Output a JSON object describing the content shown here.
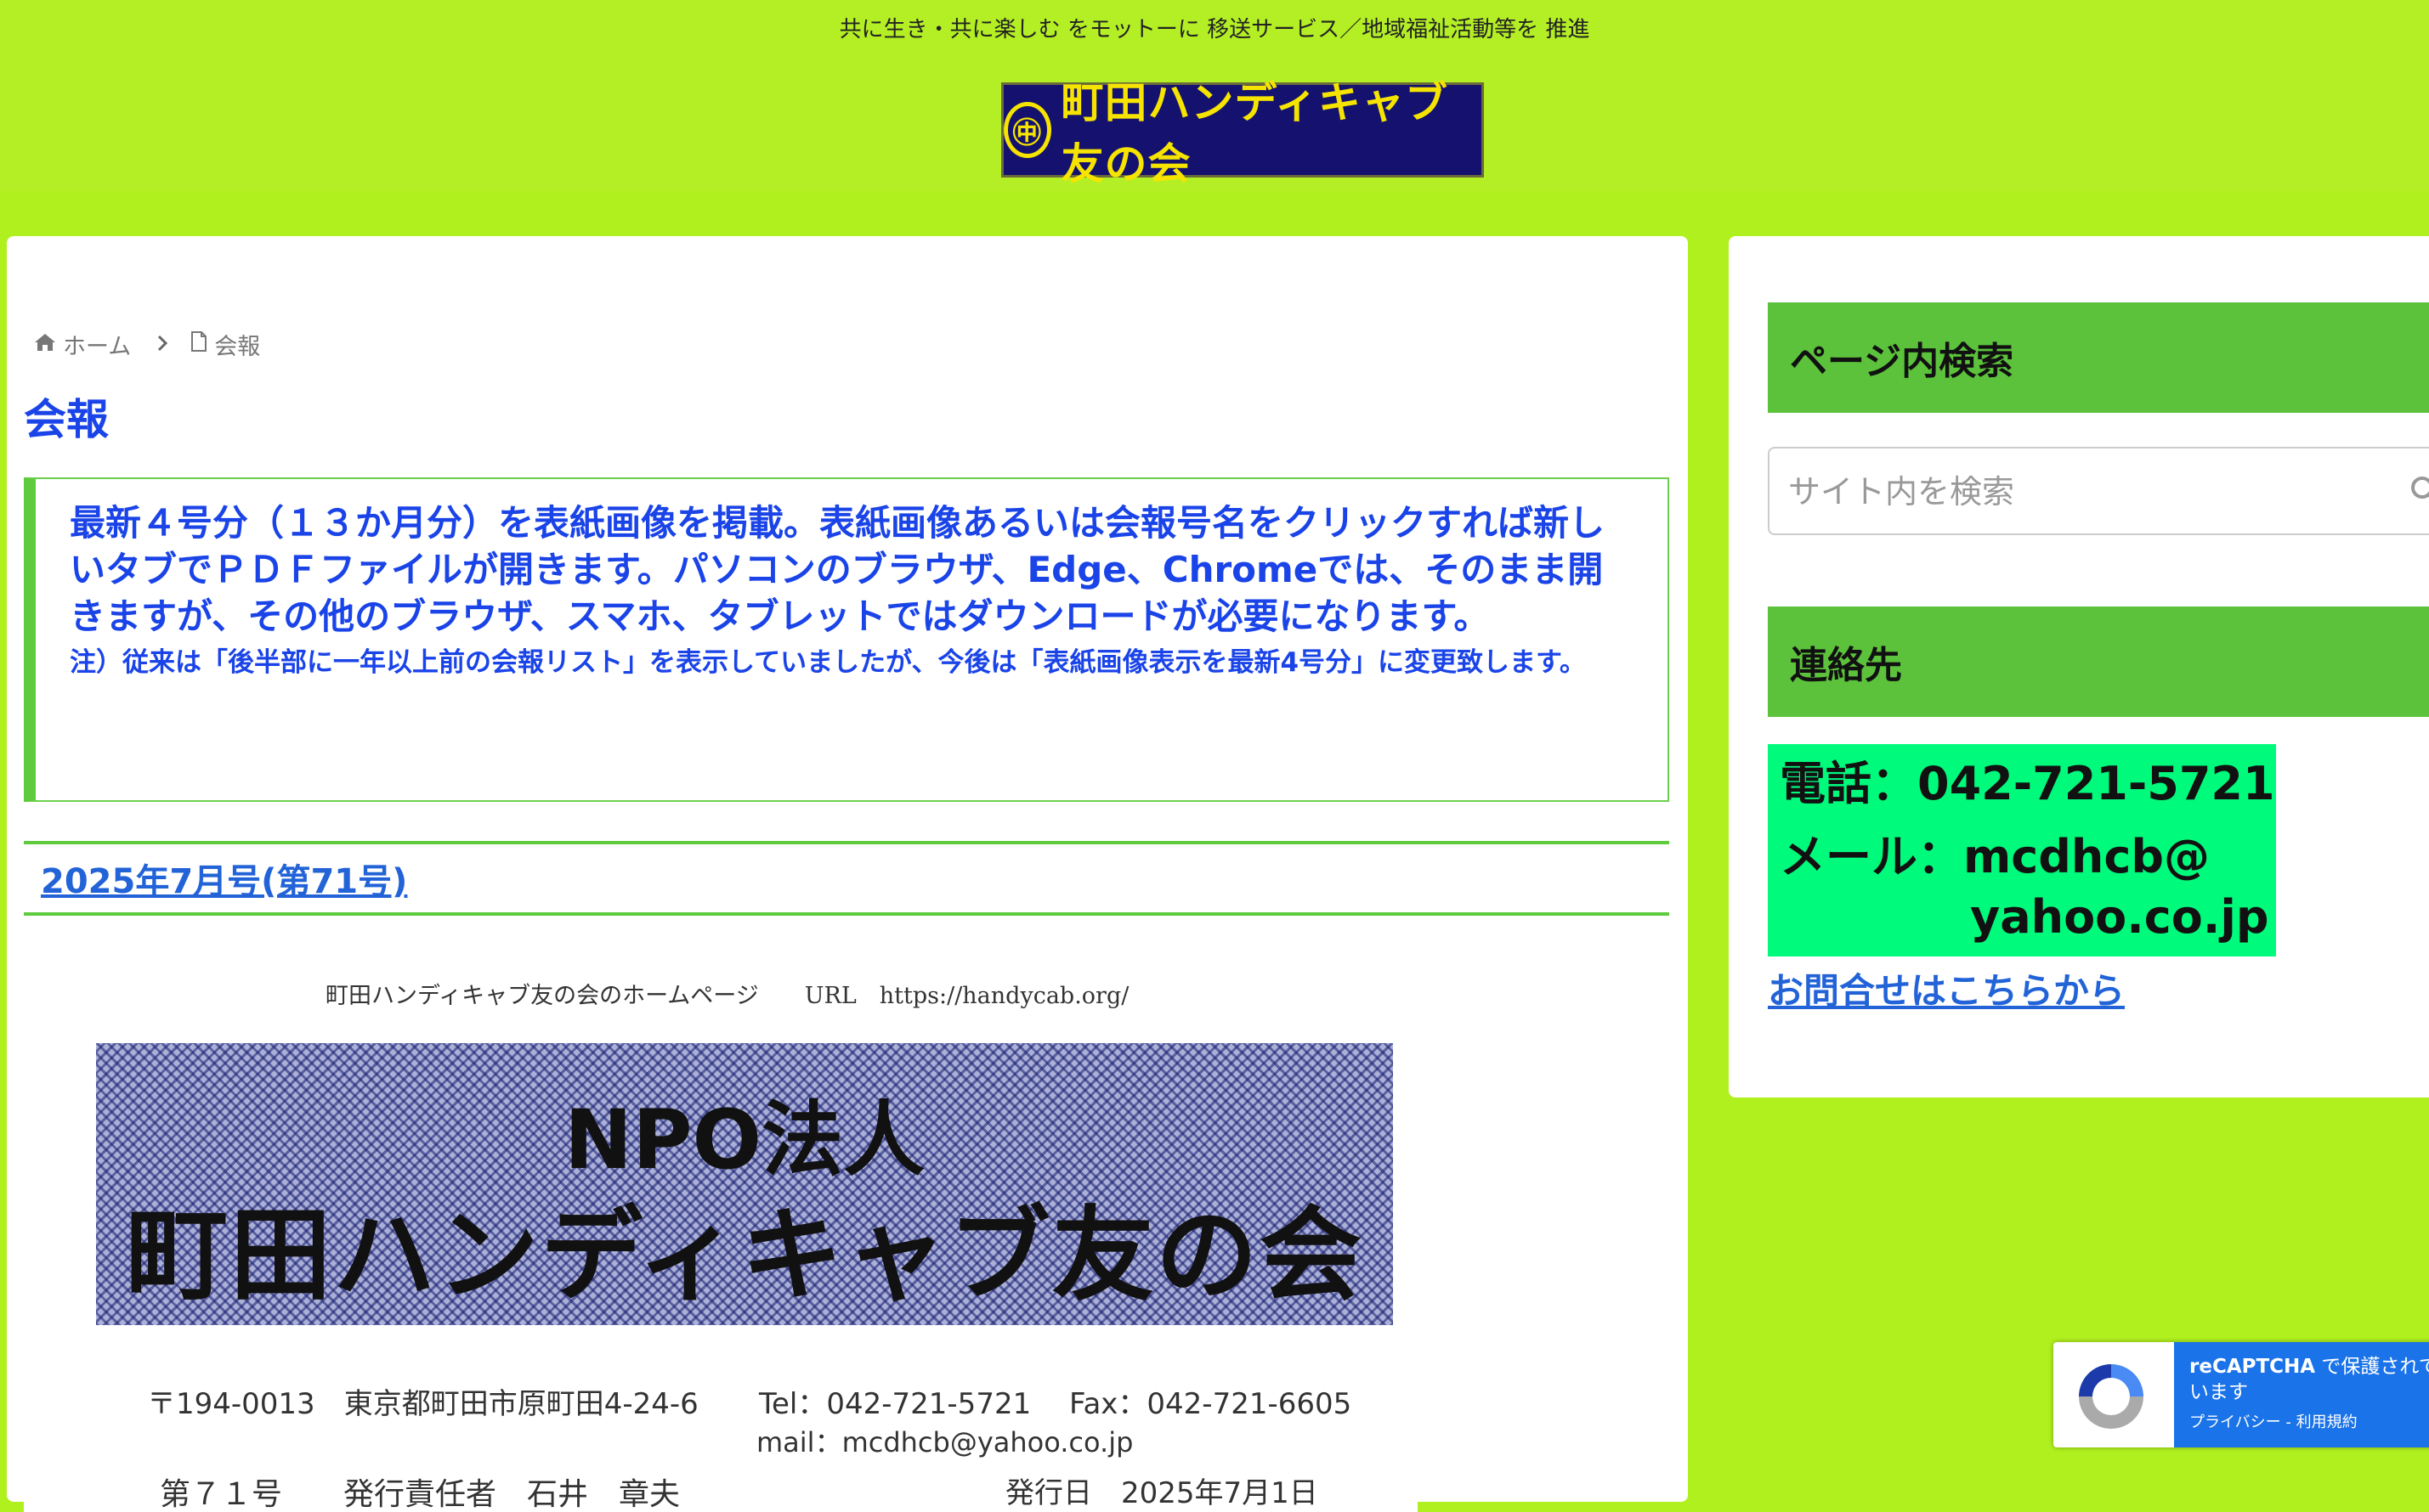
{
  "header": {
    "tagline": "共に生き・共に楽しむ をモットーに 移送サービス／地域福祉活動等を 推進",
    "logo_text": "町田ハンディキャブ友の会",
    "logo_mark": "㊥"
  },
  "breadcrumb": {
    "home": "ホーム",
    "current": "会報"
  },
  "page_title": "会報",
  "notice": {
    "main": "最新４号分（１３か月分）を表紙画像を掲載。表紙画像あるいは会報号名をクリックすれば新しいタブでＰＤＦファイルが開きます。パソコンのブラウザ、Edge、Chromeでは、そのまま開きますが、その他のブラウザ、スマホ、タブレットではダウンロードが必要になります。",
    "note": "注）従来は「後半部に一年以上前の会報リスト」を表示していましたが、今後は「表紙画像表示を最新4号分」に変更致します。"
  },
  "issue": {
    "link_label": "2025年7月号(第71号)"
  },
  "cover": {
    "url_line": "町田ハンディキャブ友の会のホームページ　　URL　https://handycab.org/",
    "npo": "NPO法人",
    "org_name": "町田ハンディキャブ友の会",
    "address": "〒194-0013　東京都町田市原町田4-24-6",
    "tel_fax": "Tel：042-721-5721　 Fax：042-721-6605",
    "mail": "mail：mcdhcb@yahoo.co.jp",
    "issue_line": "第７１号　　発行責任者　石井　章夫",
    "date_line": "発行日　2025年7月1日"
  },
  "sidebar": {
    "search_title": "ページ内検索",
    "search_placeholder": "サイト内を検索",
    "contact_title": "連絡先",
    "phone": "電話：042-721-5721",
    "mail_line1": "メール：mcdhcb@",
    "mail_line2": "yahoo.co.jp",
    "contact_link": "お問合せはこちらから"
  },
  "recaptcha": {
    "brand": "reCAPTCHA",
    "text": " で保護されています",
    "links": "プライバシー - 利用規約"
  },
  "colors": {
    "page_bg": "#b0f01e",
    "accent_green": "#5cc23c",
    "title_blue": "#1a44e8",
    "link_blue": "#2263d8",
    "contact_bg": "#00fa7c"
  }
}
